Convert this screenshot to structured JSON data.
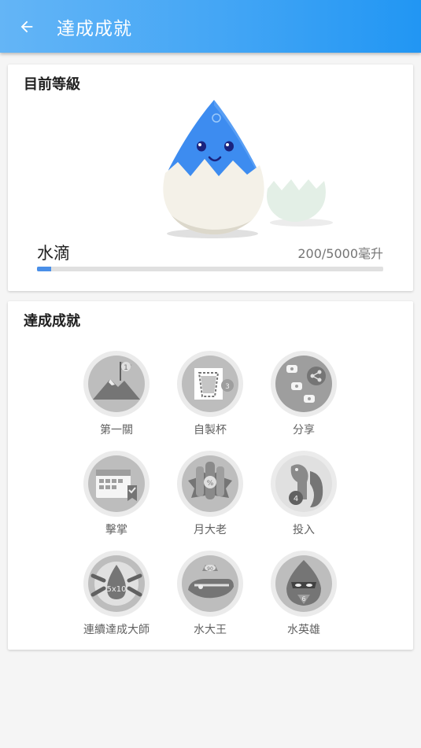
{
  "appbar": {
    "title": "達成成就",
    "back_icon": "arrow-left-icon"
  },
  "level": {
    "section_title": "目前等級",
    "name": "水滴",
    "progress_text": "200/5000毫升",
    "progress_fraction": 0.04
  },
  "achievements": {
    "section_title": "達成成就",
    "items": [
      {
        "label": "第一關",
        "icon": "mountain-flag-badge-icon"
      },
      {
        "label": "自製杯",
        "icon": "custom-cup-badge-icon"
      },
      {
        "label": "分享",
        "icon": "share-badge-icon"
      },
      {
        "label": "擊掌",
        "icon": "calendar-badge-icon"
      },
      {
        "label": "月大老",
        "icon": "bottles-badge-icon"
      },
      {
        "label": "投入",
        "icon": "squirrel-badge-icon"
      },
      {
        "label": "連續達成大師",
        "icon": "chain-drop-badge-icon"
      },
      {
        "label": "水大王",
        "icon": "whale-badge-icon"
      },
      {
        "label": "水英雄",
        "icon": "hero-badge-icon"
      }
    ]
  },
  "colors": {
    "accent": "#2196f3",
    "progress": "#4a8fe8",
    "badge_gray": "#9e9e9e"
  }
}
